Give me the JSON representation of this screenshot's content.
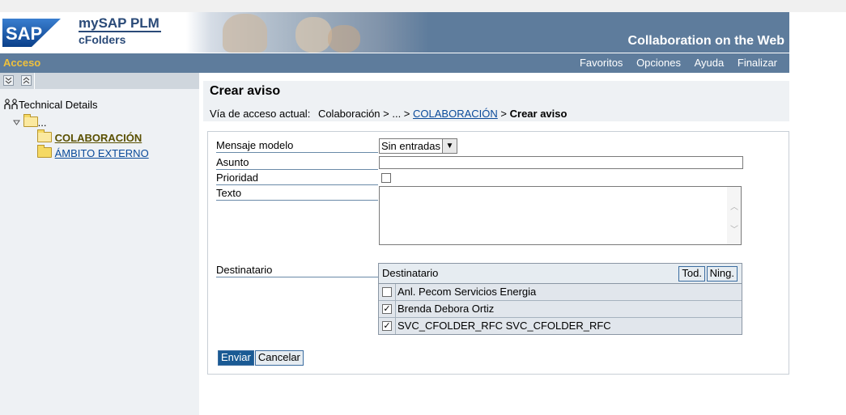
{
  "header": {
    "product_line1": "mySAP PLM",
    "product_line2": "cFolders",
    "tagline": "Collaboration on the Web",
    "logo_text": "SAP"
  },
  "navbar": {
    "section": "Acceso",
    "menu": [
      "Favoritos",
      "Opciones",
      "Ayuda",
      "Finalizar"
    ]
  },
  "sidebar": {
    "toolbar": {
      "expand_icon": "expand-all-icon",
      "collapse_icon": "collapse-all-icon"
    },
    "root_label": "Technical Details",
    "ellipsis": "...",
    "items": [
      {
        "label": "COLABORACIÓN",
        "current": true
      },
      {
        "label": "ÁMBITO EXTERNO",
        "current": false
      }
    ]
  },
  "page": {
    "title": "Crear aviso",
    "breadcrumb_label": "Vía de acceso actual:",
    "breadcrumb_part1": "Colaboración > ... >",
    "breadcrumb_link": "COLABORACIÓN",
    "breadcrumb_sep": ">",
    "breadcrumb_current": "Crear aviso"
  },
  "form": {
    "template_label": "Mensaje modelo",
    "template_value": "Sin entradas",
    "subject_label": "Asunto",
    "subject_value": "",
    "priority_label": "Prioridad",
    "priority_checked": false,
    "text_label": "Texto",
    "text_value": "",
    "recipient_label": "Destinatario"
  },
  "recipients": {
    "header": "Destinatario",
    "select_all_label": "Tod.",
    "select_none_label": "Ning.",
    "rows": [
      {
        "name": "Anl. Pecom Servicios Energia",
        "checked": false
      },
      {
        "name": "Brenda Debora Ortiz",
        "checked": true
      },
      {
        "name": "SVC_CFOLDER_RFC SVC_CFOLDER_RFC",
        "checked": true
      }
    ]
  },
  "actions": {
    "send_label": "Enviar",
    "cancel_label": "Cancelar"
  },
  "colors": {
    "banner": "#5e7c9c",
    "section_accent": "#f0c13c",
    "sidebar_bg": "#eef1f4",
    "primary_button": "#1a5a94"
  }
}
